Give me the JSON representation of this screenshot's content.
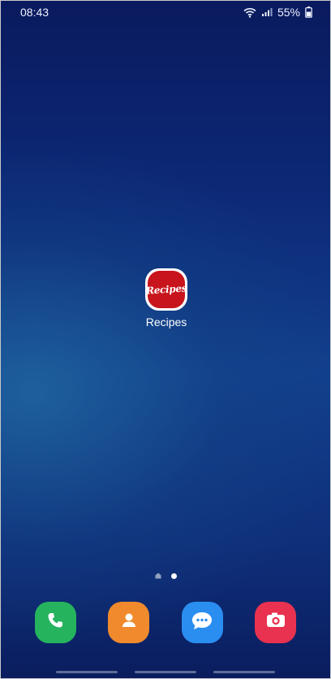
{
  "status_bar": {
    "time": "08:43",
    "battery_percent": "55%",
    "icons": [
      "wifi-icon",
      "signal-icon",
      "battery-icon"
    ]
  },
  "home_screen": {
    "apps": [
      {
        "label": "Recipes",
        "logo_text": "Recipes",
        "icon": "recipes-app-icon",
        "color": "#c8141c"
      }
    ],
    "page_indicator": {
      "pages": 2,
      "current": 2,
      "first_is_home": true
    }
  },
  "dock": {
    "apps": [
      {
        "name": "phone",
        "icon": "phone-icon",
        "color": "#26b35e"
      },
      {
        "name": "contacts",
        "icon": "contacts-icon",
        "color": "#f08a2c"
      },
      {
        "name": "messages",
        "icon": "messages-icon",
        "color": "#2a8ef0"
      },
      {
        "name": "camera",
        "icon": "camera-icon",
        "color": "#e8324f"
      }
    ]
  }
}
